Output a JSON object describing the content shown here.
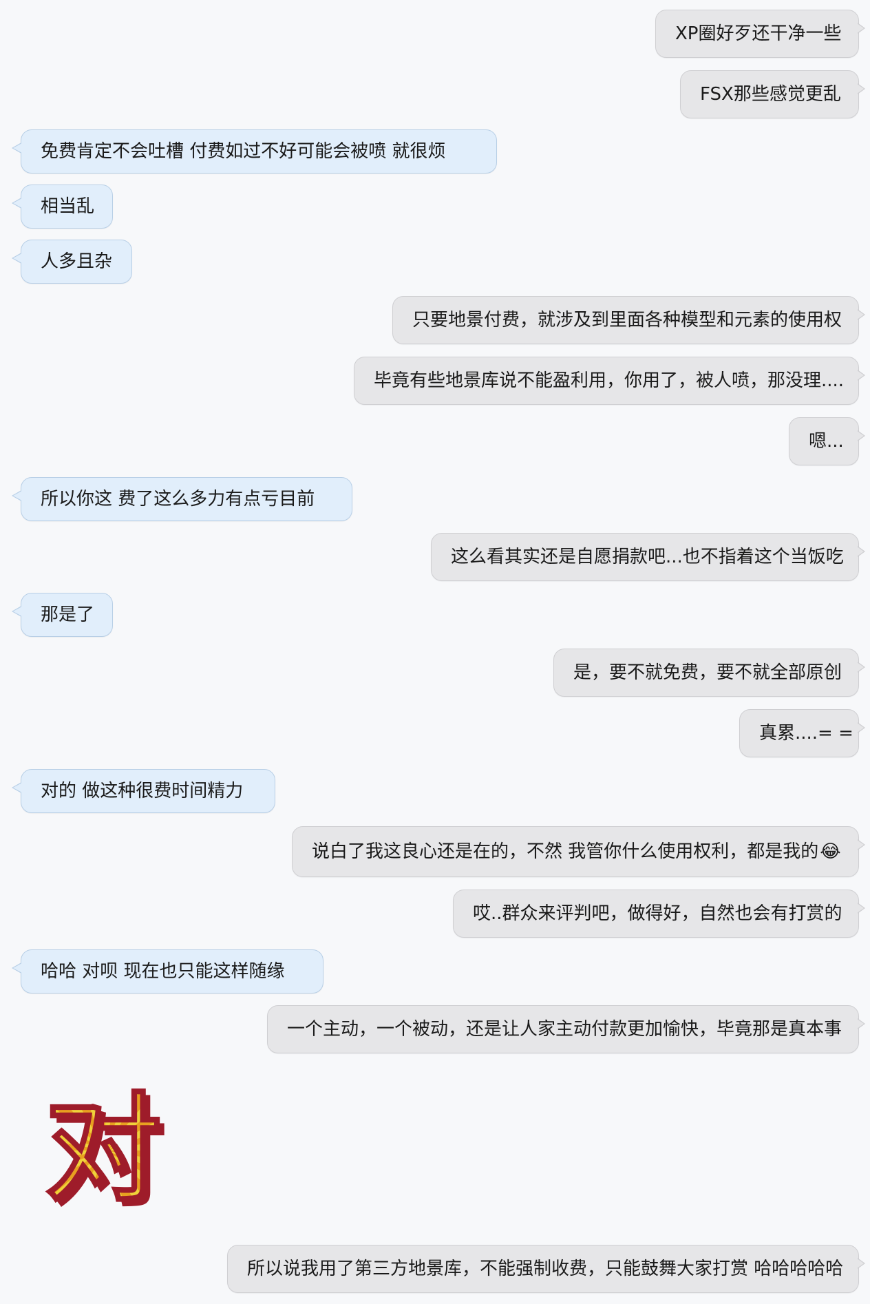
{
  "messages": [
    {
      "dir": "out",
      "text": "XP圈好歹还干净一些"
    },
    {
      "dir": "out",
      "text": "FSX那些感觉更乱"
    },
    {
      "dir": "in",
      "text": "免费肯定不会吐槽  付费如过不好可能会被喷  就很烦"
    },
    {
      "dir": "in",
      "text": "相当乱"
    },
    {
      "dir": "in",
      "text": "人多且杂"
    },
    {
      "dir": "out",
      "text": "只要地景付费，就涉及到里面各种模型和元素的使用权"
    },
    {
      "dir": "out",
      "text": "毕竟有些地景库说不能盈利用，你用了，被人喷，那没理...."
    },
    {
      "dir": "out",
      "text": "嗯..."
    },
    {
      "dir": "in",
      "text": "所以你这  费了这么多力有点亏目前"
    },
    {
      "dir": "out",
      "text": "这么看其实还是自愿捐款吧...也不指着这个当饭吃"
    },
    {
      "dir": "in",
      "text": "那是了"
    },
    {
      "dir": "out",
      "text": "是，要不就免费，要不就全部原创"
    },
    {
      "dir": "out",
      "text": "真累....= ="
    },
    {
      "dir": "in",
      "text": "对的  做这种很费时间精力"
    },
    {
      "dir": "out",
      "text": "说白了我这良心还是在的，不然 我管你什么使用权利，都是我的",
      "emoji": "😂"
    },
    {
      "dir": "out",
      "text": "哎..群众来评判吧，做得好，自然也会有打赏的"
    },
    {
      "dir": "in",
      "text": "哈哈  对呗  现在也只能这样随缘"
    },
    {
      "dir": "out",
      "text": "一个主动，一个被动，还是让人家主动付款更加愉快，毕竟那是真本事"
    },
    {
      "dir": "out",
      "text": "所以说我用了第三方地景库，不能强制收费，只能鼓舞大家打赏 哈哈哈哈哈"
    }
  ],
  "sticker": {
    "glyph": "对",
    "fill_color": "#f0d23a",
    "ray_color": "#e8a020",
    "shadow_color": "#9e1c2a"
  },
  "colors": {
    "background": "#f7f8fa",
    "outgoing_bubble": "#e6e6e8",
    "incoming_bubble": "#e1eefb"
  }
}
